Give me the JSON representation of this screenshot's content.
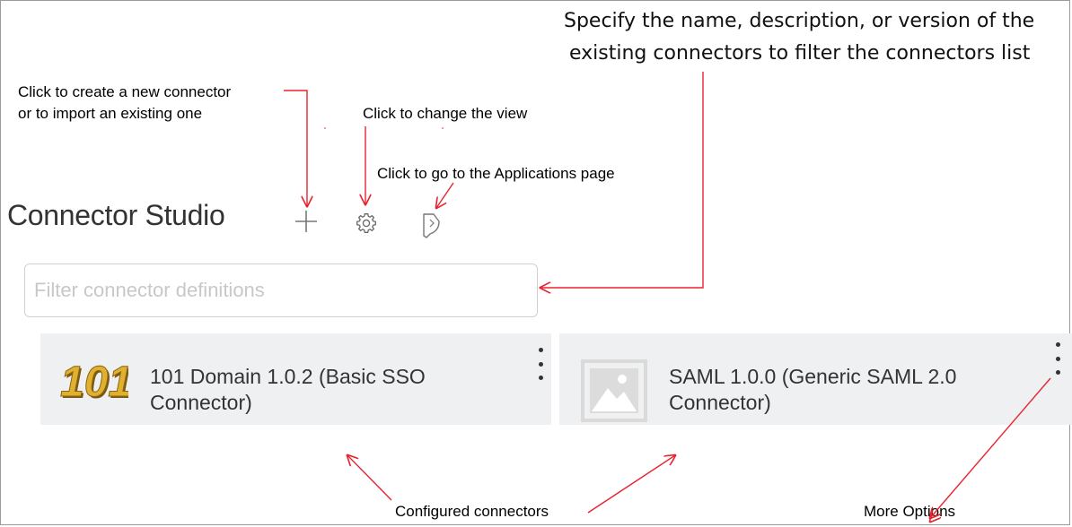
{
  "header": {
    "title": "Connector Studio",
    "add_icon": "plus-icon",
    "settings_icon": "gear-icon",
    "applications_icon": "applications-link-icon"
  },
  "filter": {
    "placeholder": "Filter connector definitions",
    "value": ""
  },
  "connectors": [
    {
      "name": "101 Domain 1.0.2 (Basic SSO",
      "name_line2": "Connector)",
      "logo_text": "101",
      "menu_icon": "more-options-icon"
    },
    {
      "name": "SAML 1.0.0 (Generic SAML 2.0",
      "name_line2": "Connector)",
      "logo_icon": "image-placeholder-icon",
      "menu_icon": "more-options-icon"
    }
  ],
  "annotations": {
    "create_line1": "Click to create a new connector",
    "create_line2": "or to import an existing one",
    "change_view": "Click to change the view",
    "applications": "Click to go to the Applications page",
    "filter_line1": "Specify the name, description, or version of the",
    "filter_line2": "existing connectors to filter the connectors list",
    "configured": "Configured connectors",
    "more_options": "More Options"
  },
  "colors": {
    "annotation_arrow": "#e8232f",
    "card_background": "#eef0f2",
    "logo_gold": "#d9a520"
  }
}
